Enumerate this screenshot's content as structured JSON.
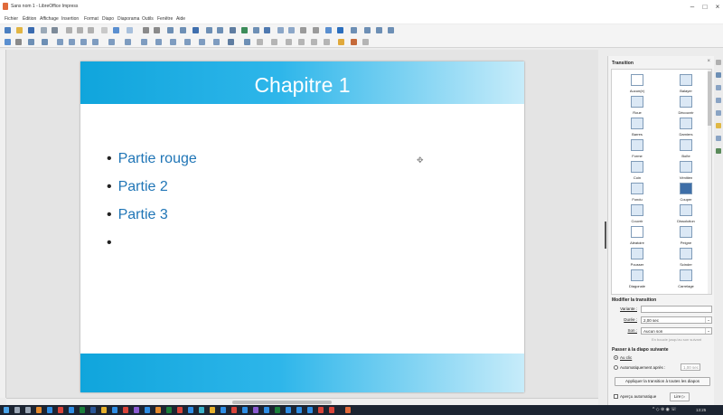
{
  "window": {
    "title": "Sans nom 1 - LibreOffice Impress",
    "minimize": "–",
    "maximize": "□",
    "close": "×"
  },
  "menu": [
    "Fichier",
    "Édition",
    "Affichage",
    "Insertion",
    "Format",
    "Diapo",
    "Diaporama",
    "Outils",
    "Fenêtre",
    "Aide"
  ],
  "slide": {
    "title": "Chapitre 1",
    "bullets": [
      "Partie rouge",
      "Partie 2",
      "Partie 3",
      ""
    ],
    "bullet_char": "•",
    "handle": "✥",
    "accent": "#10a5dc",
    "bullet_color": "#1f75b6"
  },
  "sidebar": {
    "header": "Transition",
    "close": "×",
    "transitions": [
      [
        "Aucun(e)",
        "Balayer"
      ],
      [
        "Roue",
        "Découvrir"
      ],
      [
        "Barres",
        "Damiers"
      ],
      [
        "Forme",
        "Boîte"
      ],
      [
        "Coin",
        "Vénitien"
      ],
      [
        "Fondu",
        "Couper"
      ],
      [
        "Couvrir",
        "Dissolution"
      ],
      [
        "Aléatoire",
        "Peigne"
      ],
      [
        "Pousser",
        "Scinder"
      ],
      [
        "Diagonale",
        "Carrelage"
      ]
    ],
    "modify": {
      "title": "Modifier la transition",
      "variante_label": "Variante :",
      "variante_value": "",
      "duree_label": "Durée :",
      "duree_value": "2,00 sec",
      "son_label": "Son :",
      "son_value": "Aucun son",
      "loop_hint": "En boucle jusqu'au son suivant"
    },
    "advance": {
      "title": "Passer à la diapo suivante",
      "on_click": "Au clic",
      "auto": "Automatiquement après :",
      "auto_value": "1,00 sec"
    },
    "apply_all": "Appliquer la transition à toutes les diapos",
    "autopreview": "Aperçu automatique",
    "play": "Lire ▷"
  },
  "taskbar": {
    "clock": "13:25",
    "tray": "^ ◇ ⊛ ◉ ☏"
  }
}
